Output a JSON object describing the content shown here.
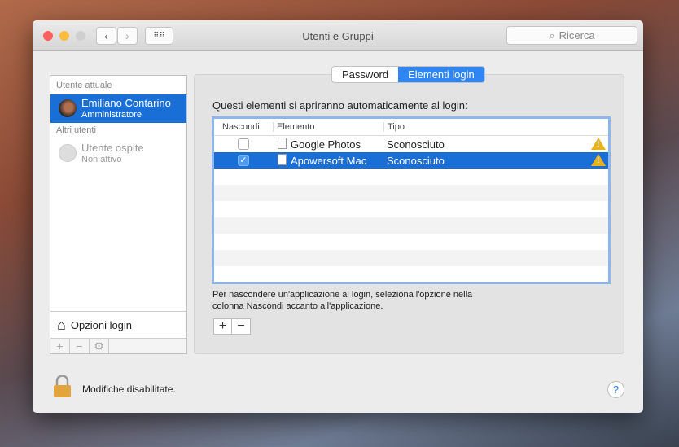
{
  "window": {
    "title": "Utenti e Gruppi",
    "search_placeholder": "Ricerca"
  },
  "sidebar": {
    "current_header": "Utente attuale",
    "current_user": {
      "name": "Emiliano Contarino",
      "role": "Amministratore"
    },
    "others_header": "Altri utenti",
    "guest": {
      "name": "Utente ospite",
      "status": "Non attivo"
    },
    "login_options": "Opzioni login"
  },
  "tabs": [
    {
      "label": "Password"
    },
    {
      "label": "Elementi login"
    }
  ],
  "main": {
    "label": "Questi elementi si apriranno automaticamente al login:",
    "columns": [
      "Nascondi",
      "Elemento",
      "Tipo"
    ],
    "rows": [
      {
        "hide": false,
        "name": "Google Photos",
        "type": "Sconosciuto"
      },
      {
        "hide": true,
        "name": "Apowersoft Mac",
        "type": "Sconosciuto"
      }
    ],
    "help": "Per nascondere un'applicazione al login, seleziona l'opzione nella colonna Nascondi accanto all'applicazione.",
    "add": "+",
    "remove": "−"
  },
  "footer": {
    "lock_text": "Modifiche disabilitate.",
    "help": "?"
  }
}
